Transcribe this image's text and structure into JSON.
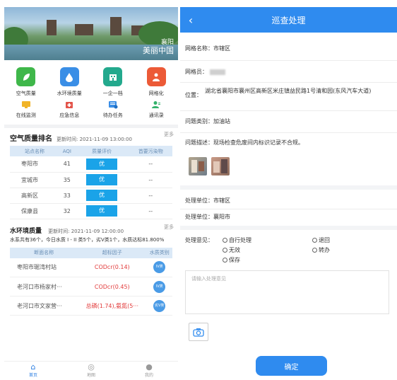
{
  "left": {
    "banner": {
      "slogan_small": "襄阳",
      "slogan_big": "美丽中国"
    },
    "menu_row1": [
      {
        "label": "空气质量",
        "icon": "leaf-icon",
        "color": "#3fb74a"
      },
      {
        "label": "水环境质量",
        "icon": "water-drop-icon",
        "color": "#3a8ee6"
      },
      {
        "label": "一企一档",
        "icon": "factory-icon",
        "color": "#23a98d"
      },
      {
        "label": "网格化",
        "icon": "person-grid-icon",
        "color": "#ec5a37"
      }
    ],
    "menu_row2": [
      {
        "label": "在线监测",
        "icon": "monitor-icon",
        "color": "#f1b428"
      },
      {
        "label": "应急信息",
        "icon": "emergency-icon",
        "color": "#e3544a"
      },
      {
        "label": "待办任务",
        "icon": "task-icon",
        "color": "#3a8ee6"
      },
      {
        "label": "通讯录",
        "icon": "contacts-icon",
        "color": "#33b26b"
      }
    ],
    "air_ranking": {
      "title": "空气质量排名",
      "update_time": "更新时间: 2021-11-09 13:00:00",
      "more": "更多",
      "headers": [
        "站点名称",
        "AQI",
        "质量评价",
        "首要污染物"
      ],
      "rows": [
        {
          "name": "枣阳市",
          "aqi": "41",
          "rating": "优",
          "pollutant": "--"
        },
        {
          "name": "宜城市",
          "aqi": "35",
          "rating": "优",
          "pollutant": "--"
        },
        {
          "name": "高新区",
          "aqi": "33",
          "rating": "优",
          "pollutant": "--"
        },
        {
          "name": "保康县",
          "aqi": "32",
          "rating": "优",
          "pollutant": "--"
        }
      ]
    },
    "water_quality": {
      "title": "水环境质量",
      "update_time": "更新时间: 2021-11-09 12:00:00",
      "more": "更多",
      "summary": "水系共有36个，今日水质 I - II 类5个，劣V类1个，水质达标81.800%",
      "headers": [
        "断面名称",
        "超标因子",
        "水质类别"
      ],
      "rows": [
        {
          "name": "枣阳市琚湾村站",
          "factor": "CODcr(0.14)",
          "class": "IV类"
        },
        {
          "name": "老河口市杨家村···",
          "factor": "CODcr(0.45)",
          "class": "IV类"
        },
        {
          "name": "老河口市文家营···",
          "factor": "总磷(1.74),氨氮(5···",
          "class": "劣V类"
        }
      ]
    },
    "tabbar": [
      {
        "label": "首页",
        "icon": "home-icon",
        "active": true
      },
      {
        "label": "地图",
        "icon": "map-icon",
        "active": false
      },
      {
        "label": "我的",
        "icon": "user-icon",
        "active": false
      }
    ]
  },
  "right": {
    "nav": {
      "title": "巡查处理",
      "back": "‹"
    },
    "grid_name": {
      "label": "网格名称：",
      "value": "市辖区"
    },
    "grid_member": {
      "label": "网格员：",
      "value": ""
    },
    "location": {
      "label": "位置：",
      "value": "湖北省襄阳市襄州区高新区米庄镇益民路1号清和园(东风汽车大道)"
    },
    "category": {
      "label": "问题类别：",
      "value": "加油站"
    },
    "description": {
      "label": "问题描述：",
      "value": "现场检查危废间内标识记录不合规。"
    },
    "unit1": {
      "label": "处理单位：",
      "value": "市辖区"
    },
    "unit2": {
      "label": "处理单位：",
      "value": "襄阳市"
    },
    "opinion": {
      "label": "处理意见：",
      "options": [
        "自行处理",
        "退回",
        "无效",
        "转办",
        "保存"
      ]
    },
    "textarea_placeholder": "请输入处理意见",
    "confirm": "确定"
  }
}
